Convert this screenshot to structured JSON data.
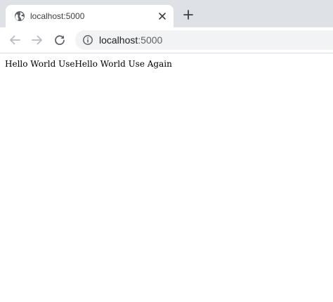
{
  "tab": {
    "title": "localhost:5000",
    "favicon": "globe-icon",
    "close_icon": "close-icon"
  },
  "newtab_icon": "plus-icon",
  "toolbar": {
    "back_icon": "arrow-left-icon",
    "forward_icon": "arrow-right-icon",
    "reload_icon": "reload-icon",
    "info_icon": "info-icon",
    "url_host": "localhost",
    "url_port": ":5000"
  },
  "page": {
    "text": "Hello World UseHello World Use Again"
  },
  "colors": {
    "tabstrip": "#dee1e6",
    "omnibox": "#f1f3f4",
    "icon": "#5f6368",
    "icon_disabled": "#b8bcc2"
  }
}
